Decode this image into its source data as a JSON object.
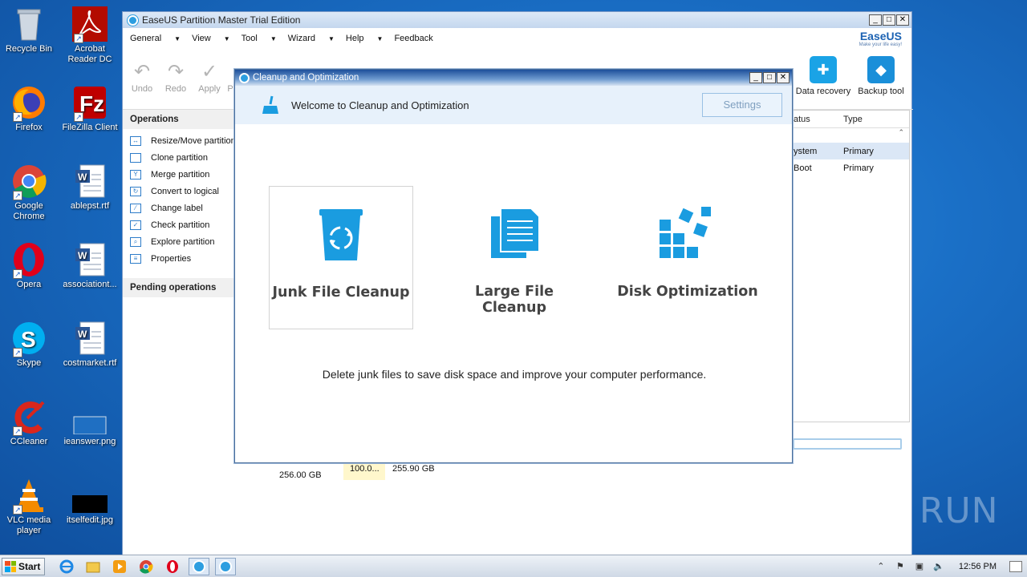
{
  "desktop": {
    "icons": [
      {
        "label": "Recycle Bin",
        "icon": "recycle-bin-icon"
      },
      {
        "label": "Acrobat Reader DC",
        "icon": "acrobat-icon"
      },
      {
        "label": "Firefox",
        "icon": "firefox-icon"
      },
      {
        "label": "FileZilla Client",
        "icon": "filezilla-icon"
      },
      {
        "label": "Google Chrome",
        "icon": "chrome-icon"
      },
      {
        "label": "ablepst.rtf",
        "icon": "word-doc-icon"
      },
      {
        "label": "Opera",
        "icon": "opera-icon"
      },
      {
        "label": "associationt...",
        "icon": "word-doc-icon"
      },
      {
        "label": "Skype",
        "icon": "skype-icon"
      },
      {
        "label": "costmarket.rtf",
        "icon": "word-doc-icon"
      },
      {
        "label": "CCleaner",
        "icon": "ccleaner-icon"
      },
      {
        "label": "ieanswer.png",
        "icon": "image-file-icon"
      },
      {
        "label": "VLC media player",
        "icon": "vlc-icon"
      },
      {
        "label": "itselfedit.jpg",
        "icon": "image-file-icon"
      }
    ]
  },
  "main_window": {
    "title": "EaseUS Partition Master Trial Edition",
    "menu": [
      "General",
      "View",
      "Tool",
      "Wizard",
      "Help",
      "Feedback"
    ],
    "logo_text": "EaseUS",
    "logo_tagline": "Make your life easy!",
    "toolbar": {
      "undo": "Undo",
      "redo": "Redo",
      "apply": "Apply",
      "partial": "P"
    },
    "toolbar_right": {
      "data_recovery": "Data recovery",
      "backup_tool": "Backup tool"
    },
    "operations_header": "Operations",
    "operations": [
      "Resize/Move partition",
      "Clone partition",
      "Merge partition",
      "Convert to logical",
      "Change label",
      "Check partition",
      "Explore partition",
      "Properties"
    ],
    "pending_header": "Pending operations",
    "grid": {
      "col_status": "atus",
      "col_type": "Type",
      "rows": [
        {
          "status": "ystem",
          "type": "Primary"
        },
        {
          "status": "Boot",
          "type": "Primary"
        }
      ]
    },
    "disk": {
      "size": "256.00 GB",
      "pct": "100.0...",
      "partition_size": "255.90 GB"
    }
  },
  "dialog": {
    "title": "Cleanup and Optimization",
    "header": "Welcome to Cleanup and Optimization",
    "settings_label": "Settings",
    "cards": [
      {
        "label": "Junk File Cleanup"
      },
      {
        "label": "Large File Cleanup"
      },
      {
        "label": "Disk Optimization"
      }
    ],
    "description": "Delete junk files to save disk space and improve your computer performance."
  },
  "taskbar": {
    "start_label": "Start",
    "clock": "12:56 PM"
  },
  "watermark": "ANY RUN",
  "colors": {
    "accent": "#1a9ce0",
    "dialog_header_bg": "#e7f1fb"
  }
}
